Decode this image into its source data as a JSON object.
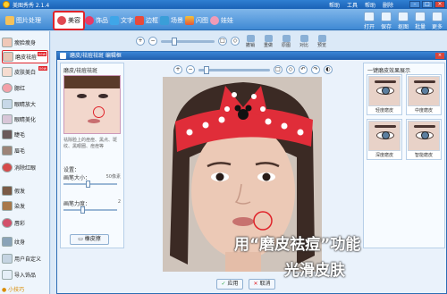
{
  "app": {
    "title": "美图秀秀 2.1.4",
    "menu": [
      "帮助",
      "工具",
      "帮助",
      "删除"
    ]
  },
  "toolbar": {
    "tabs": [
      {
        "label": "图片处理",
        "icon": "image-icon"
      },
      {
        "label": "美容",
        "icon": "face-icon"
      },
      {
        "label": "饰品",
        "icon": "heart-icon"
      },
      {
        "label": "文字",
        "icon": "text-icon"
      },
      {
        "label": "边框",
        "icon": "frame-icon"
      },
      {
        "label": "场景",
        "icon": "scene-icon"
      },
      {
        "label": "闪图",
        "icon": "flash-icon"
      },
      {
        "label": "娃娃",
        "icon": "doll-icon"
      }
    ],
    "right_tools": [
      {
        "label": "打开",
        "icon": "open-icon"
      },
      {
        "label": "保存",
        "icon": "save-icon"
      },
      {
        "label": "抠图",
        "icon": "cutout-icon"
      },
      {
        "label": "批量",
        "icon": "batch-icon"
      },
      {
        "label": "更多",
        "icon": "more-icon"
      }
    ]
  },
  "sidebar": {
    "items": [
      {
        "label": "瘦脸瘦身",
        "new": false
      },
      {
        "label": "磨皮祛痘",
        "new": true
      },
      {
        "label": "皮肤美白",
        "new": true
      },
      {
        "label": "腮红",
        "new": false
      },
      {
        "label": "眼睛放大",
        "new": false
      },
      {
        "label": "眼睛美化",
        "new": false
      },
      {
        "label": "睫毛",
        "new": false
      },
      {
        "label": "眉毛",
        "new": false
      },
      {
        "label": "消除红眼",
        "new": false
      },
      {
        "label": "假发",
        "new": false
      },
      {
        "label": "染发",
        "new": false
      },
      {
        "label": "唇彩",
        "new": false
      },
      {
        "label": "纹身",
        "new": false
      },
      {
        "label": "用户自定义",
        "new": false
      },
      {
        "label": "导入饰品",
        "new": false
      }
    ],
    "tip": "小技巧"
  },
  "workarea": {
    "tools": [
      "撤销",
      "重做",
      "原图",
      "对比",
      "预览"
    ]
  },
  "dialog": {
    "title": "磨皮/祛痘祛斑 编辑框",
    "settings_title": "磨皮/祛痘祛斑",
    "description": "祛除脸上的痘痘、黑点、斑纹、黑眼圈、痘痘等",
    "section_label": "设置：",
    "brush_size_label": "画笔大小：",
    "brush_size_value": "50像素",
    "brush_size_value_fraction": 0.45,
    "brush_strength_label": "画笔力度：",
    "brush_strength_value": "2",
    "brush_strength_value_fraction": 0.35,
    "eraser_label": "橡皮擦",
    "right_panel_title": "一键磨皮效果展示",
    "thumbnails": [
      {
        "label": "轻度磨皮"
      },
      {
        "label": "中度磨皮"
      },
      {
        "label": "深度磨皮"
      },
      {
        "label": "智能磨皮"
      }
    ],
    "apply_label": "应用",
    "cancel_label": "取消",
    "overlay_line1": "用“磨皮祛痘”功能",
    "overlay_line2": "光滑皮肤"
  },
  "colors": {
    "accent_red": "#e0232a",
    "toolbar_blue": "#3f89d4",
    "panel_bg": "#eaf2fb"
  }
}
